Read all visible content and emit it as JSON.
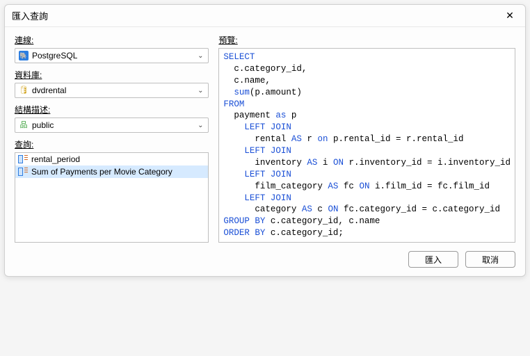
{
  "dialog": {
    "title": "匯入查詢"
  },
  "labels": {
    "connection": "連線:",
    "database": "資料庫:",
    "schema": "結構描述:",
    "query": "查詢:",
    "preview": "預覽:"
  },
  "combos": {
    "connection": "PostgreSQL",
    "database": "dvdrental",
    "schema": "public"
  },
  "queries": {
    "items": [
      {
        "label": "rental_period",
        "selected": false
      },
      {
        "label": "Sum of Payments per Movie Category",
        "selected": true
      }
    ]
  },
  "preview_tokens": [
    [
      "kw",
      "SELECT"
    ],
    [
      "nl",
      ""
    ],
    [
      "tx",
      "  c.category_id,"
    ],
    [
      "nl",
      ""
    ],
    [
      "tx",
      "  c.name,"
    ],
    [
      "nl",
      ""
    ],
    [
      "tx",
      "  "
    ],
    [
      "kw",
      "sum"
    ],
    [
      "tx",
      "(p.amount)"
    ],
    [
      "nl",
      ""
    ],
    [
      "kw",
      "FROM"
    ],
    [
      "nl",
      ""
    ],
    [
      "tx",
      "  payment "
    ],
    [
      "kw",
      "as"
    ],
    [
      "tx",
      " p"
    ],
    [
      "nl",
      ""
    ],
    [
      "tx",
      "    "
    ],
    [
      "kw",
      "LEFT JOIN"
    ],
    [
      "nl",
      ""
    ],
    [
      "tx",
      "      rental "
    ],
    [
      "kw",
      "AS"
    ],
    [
      "tx",
      " r "
    ],
    [
      "kw",
      "on"
    ],
    [
      "tx",
      " p.rental_id = r.rental_id"
    ],
    [
      "nl",
      ""
    ],
    [
      "tx",
      "    "
    ],
    [
      "kw",
      "LEFT JOIN"
    ],
    [
      "nl",
      ""
    ],
    [
      "tx",
      "      inventory "
    ],
    [
      "kw",
      "AS"
    ],
    [
      "tx",
      " i "
    ],
    [
      "kw",
      "ON"
    ],
    [
      "tx",
      " r.inventory_id = i.inventory_id"
    ],
    [
      "nl",
      ""
    ],
    [
      "tx",
      "    "
    ],
    [
      "kw",
      "LEFT JOIN"
    ],
    [
      "nl",
      ""
    ],
    [
      "tx",
      "      film_category "
    ],
    [
      "kw",
      "AS"
    ],
    [
      "tx",
      " fc "
    ],
    [
      "kw",
      "ON"
    ],
    [
      "tx",
      " i.film_id = fc.film_id"
    ],
    [
      "nl",
      ""
    ],
    [
      "tx",
      "    "
    ],
    [
      "kw",
      "LEFT JOIN"
    ],
    [
      "nl",
      ""
    ],
    [
      "tx",
      "      category "
    ],
    [
      "kw",
      "AS"
    ],
    [
      "tx",
      " c "
    ],
    [
      "kw",
      "ON"
    ],
    [
      "tx",
      " fc.category_id = c.category_id"
    ],
    [
      "nl",
      ""
    ],
    [
      "kw",
      "GROUP BY"
    ],
    [
      "tx",
      " c.category_id, c.name"
    ],
    [
      "nl",
      ""
    ],
    [
      "kw",
      "ORDER BY"
    ],
    [
      "tx",
      " c.category_id;"
    ]
  ],
  "buttons": {
    "import": "匯入",
    "cancel": "取消"
  }
}
